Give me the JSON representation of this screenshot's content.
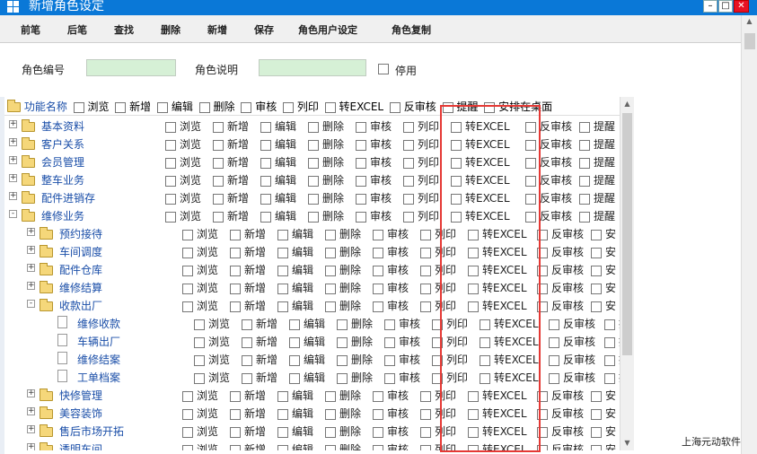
{
  "window": {
    "title": "新增角色设定"
  },
  "toolbar": {
    "buttons": [
      "前笔",
      "后笔",
      "查找",
      "删除",
      "新增",
      "保存",
      "角色用户设定",
      "角色复制"
    ]
  },
  "form": {
    "role_code_label": "角色编号",
    "role_code_value": "",
    "role_desc_label": "角色说明",
    "role_desc_value": "",
    "disable_label": "停用"
  },
  "header": {
    "root_label": "功能名称",
    "perm_labels": [
      "浏览",
      "新增",
      "编辑",
      "删除",
      "审核",
      "列印",
      "转EXCEL",
      "反审核",
      "提醒",
      "安排在桌面"
    ]
  },
  "perm_labels": [
    "浏览",
    "新增",
    "编辑",
    "删除",
    "审核",
    "列印",
    "转EXCEL",
    "反审核",
    "提醒"
  ],
  "tree": [
    {
      "label": "基本资料",
      "level": 0,
      "type": "folder",
      "expander": "+"
    },
    {
      "label": "客户关系",
      "level": 0,
      "type": "folder",
      "expander": "+"
    },
    {
      "label": "会员管理",
      "level": 0,
      "type": "folder",
      "expander": "+"
    },
    {
      "label": "整车业务",
      "level": 0,
      "type": "folder",
      "expander": "+"
    },
    {
      "label": "配件进销存",
      "level": 0,
      "type": "folder",
      "expander": "+"
    },
    {
      "label": "维修业务",
      "level": 0,
      "type": "folder",
      "expander": "-"
    },
    {
      "label": "预约接待",
      "level": 1,
      "type": "folder",
      "expander": "+"
    },
    {
      "label": "车间调度",
      "level": 1,
      "type": "folder",
      "expander": "+"
    },
    {
      "label": "配件仓库",
      "level": 1,
      "type": "folder",
      "expander": "+"
    },
    {
      "label": "维修结算",
      "level": 1,
      "type": "folder",
      "expander": "+"
    },
    {
      "label": "收款出厂",
      "level": 1,
      "type": "folder",
      "expander": "-"
    },
    {
      "label": "维修收款",
      "level": 2,
      "type": "doc",
      "expander": ""
    },
    {
      "label": "车辆出厂",
      "level": 2,
      "type": "doc",
      "expander": ""
    },
    {
      "label": "维修结案",
      "level": 2,
      "type": "doc",
      "expander": ""
    },
    {
      "label": "工单档案",
      "level": 2,
      "type": "doc",
      "expander": ""
    },
    {
      "label": "快修管理",
      "level": 1,
      "type": "folder",
      "expander": "+"
    },
    {
      "label": "美容装饰",
      "level": 1,
      "type": "folder",
      "expander": "+"
    },
    {
      "label": "售后市场开拓",
      "level": 1,
      "type": "folder",
      "expander": "+"
    },
    {
      "label": "透明车间",
      "level": 1,
      "type": "folder",
      "expander": "+"
    }
  ],
  "truncated_last_label": "安",
  "footer": {
    "company": "上海元动软件"
  }
}
